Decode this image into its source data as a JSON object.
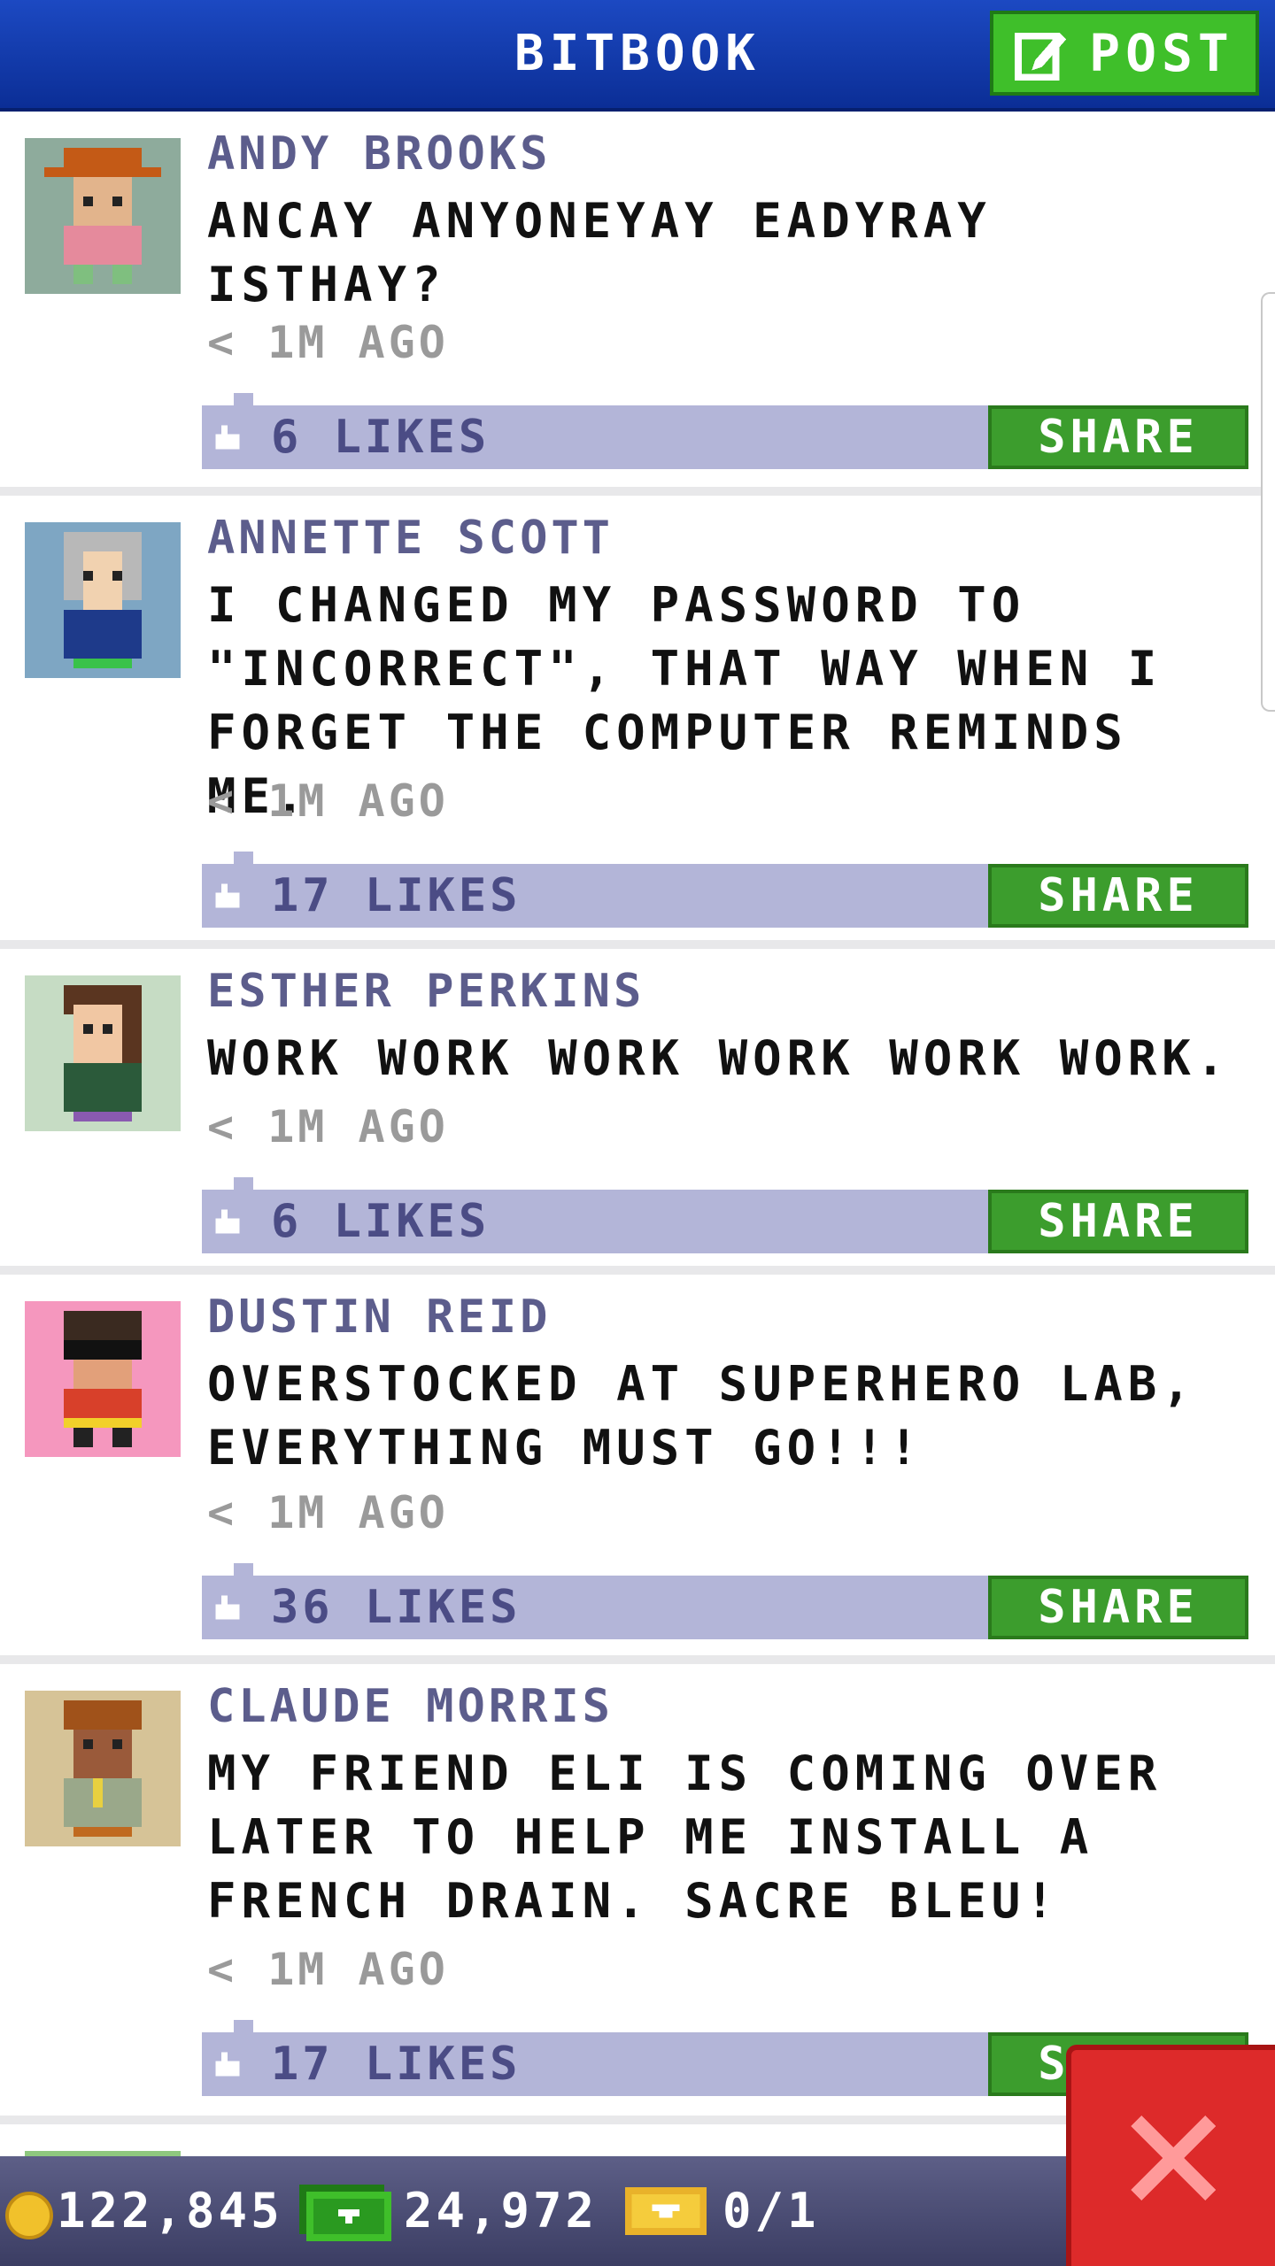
{
  "header": {
    "title": "BITBOOK",
    "post_label": "POST"
  },
  "posts": [
    {
      "name": "ANDY BROOKS",
      "text": "ANCAY ANYONEYAY EADYRAY ISTHAY?",
      "time": "< 1M AGO",
      "likes": "6 LIKES",
      "share": "SHARE",
      "avatar_bg": "#8eab9c"
    },
    {
      "name": "ANNETTE SCOTT",
      "text": "I CHANGED MY PASSWORD TO \"INCORRECT\", THAT WAY WHEN I FORGET THE COMPUTER REMINDS ME.",
      "time": "< 1M AGO",
      "likes": "17 LIKES",
      "share": "SHARE",
      "avatar_bg": "#7ea6c3"
    },
    {
      "name": "ESTHER PERKINS",
      "text": "WORK WORK WORK WORK WORK WORK.",
      "time": "< 1M AGO",
      "likes": "6 LIKES",
      "share": "SHARE",
      "avatar_bg": "#c6dcc4"
    },
    {
      "name": "DUSTIN REID",
      "text": "OVERSTOCKED AT SUPERHERO LAB, EVERYTHING MUST GO!!!",
      "time": "< 1M AGO",
      "likes": "36 LIKES",
      "share": "SHARE",
      "avatar_bg": "#f597be"
    },
    {
      "name": "CLAUDE MORRIS",
      "text": "MY FRIEND ELI IS COMING OVER LATER TO HELP ME INSTALL A FRENCH DRAIN. SACRE BLEU!",
      "time": "< 1M AGO",
      "likes": "17 LIKES",
      "share": "SHARE",
      "avatar_bg": "#d6c397"
    }
  ],
  "resources": {
    "coins": "122,845",
    "bux": "24,972",
    "tickets": "0/1"
  },
  "colors": {
    "header_blue": "#1c49c2",
    "post_green": "#3fbf2a",
    "share_green": "#3c9d2d",
    "likes_bar": "#b3b5d8",
    "name_purple": "#5c5d8c",
    "close_red": "#dd2a2a"
  }
}
